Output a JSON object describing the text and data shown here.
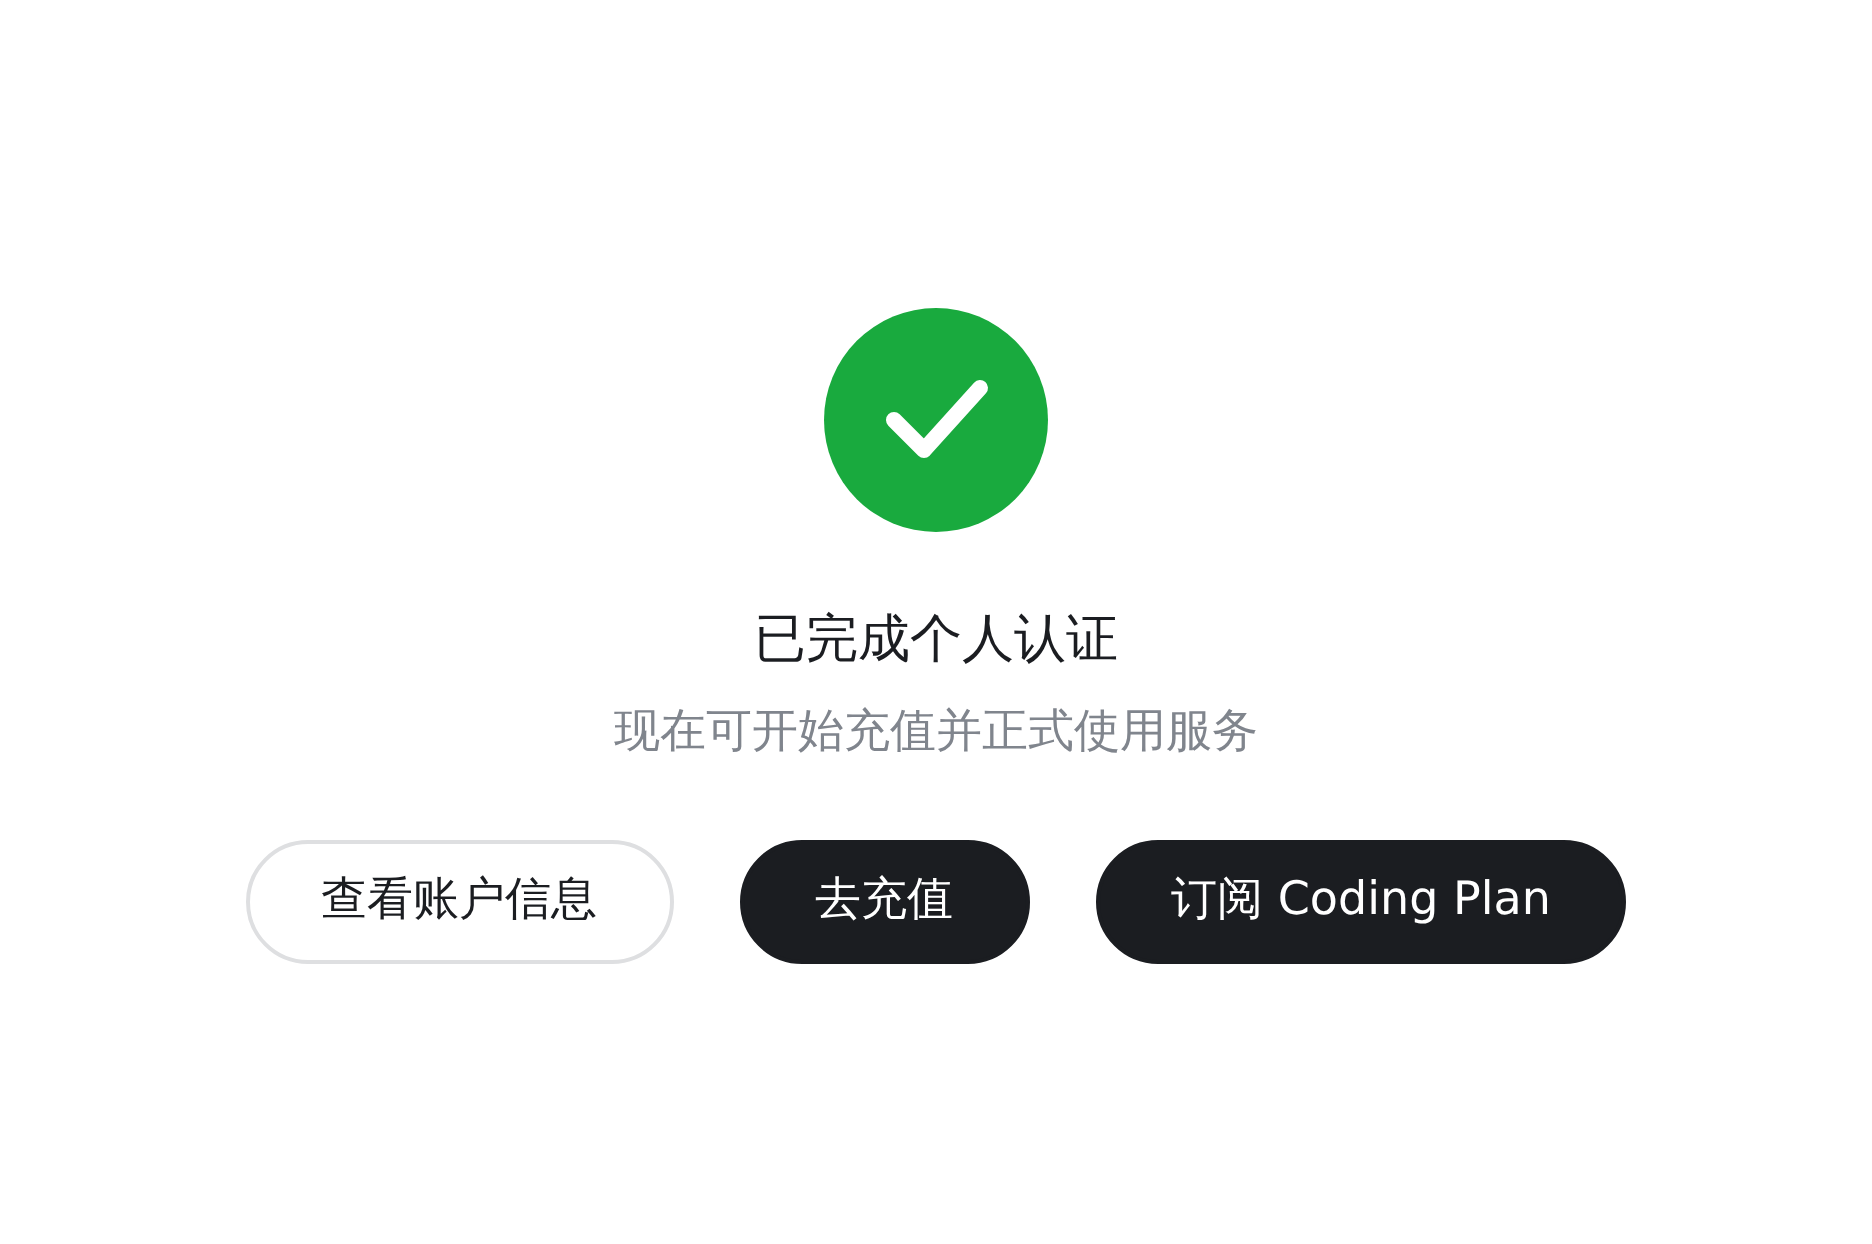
{
  "status": {
    "kind": "success"
  },
  "title": "已完成个人认证",
  "subtitle": "现在可开始充值并正式使用服务",
  "buttons": [
    {
      "label": "查看账户信息",
      "kind": "outline"
    },
    {
      "label": "去充值",
      "kind": "dark"
    },
    {
      "label": "订阅 Coding Plan",
      "kind": "dark"
    }
  ]
}
